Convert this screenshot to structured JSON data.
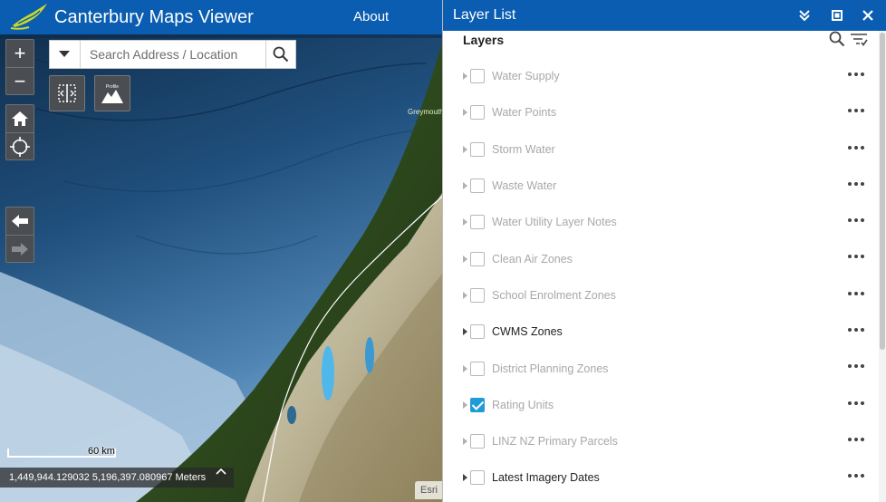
{
  "header": {
    "title": "Canterbury Maps Viewer",
    "about": "About"
  },
  "search": {
    "placeholder": "Search Address / Location"
  },
  "map": {
    "place_label": "Greymouth",
    "scale_label": "60 km",
    "coordinates": "1,449,944.129032 5,196,397.080967 Meters",
    "attribution": "Esri"
  },
  "tools": {
    "zoom_in": "+",
    "zoom_out": "−",
    "profile_label": "Profile"
  },
  "panel": {
    "title": "Layer List",
    "heading": "Layers",
    "layers": [
      {
        "label": "Water Supply",
        "checked": false,
        "visible_in_scale": false
      },
      {
        "label": "Water Points",
        "checked": false,
        "visible_in_scale": false
      },
      {
        "label": "Storm Water",
        "checked": false,
        "visible_in_scale": false
      },
      {
        "label": "Waste Water",
        "checked": false,
        "visible_in_scale": false
      },
      {
        "label": "Water Utility Layer Notes",
        "checked": false,
        "visible_in_scale": false
      },
      {
        "label": "Clean Air Zones",
        "checked": false,
        "visible_in_scale": false
      },
      {
        "label": "School Enrolment Zones",
        "checked": false,
        "visible_in_scale": false
      },
      {
        "label": "CWMS Zones",
        "checked": false,
        "visible_in_scale": true
      },
      {
        "label": "District Planning Zones",
        "checked": false,
        "visible_in_scale": false
      },
      {
        "label": "Rating Units",
        "checked": true,
        "visible_in_scale": false
      },
      {
        "label": "LINZ NZ Primary Parcels",
        "checked": false,
        "visible_in_scale": false
      },
      {
        "label": "Latest Imagery Dates",
        "checked": false,
        "visible_in_scale": true
      }
    ]
  },
  "colors": {
    "header_blue": "#0a5db1",
    "check_blue": "#1f9bd7",
    "inactive_text": "#a8a8a8"
  }
}
